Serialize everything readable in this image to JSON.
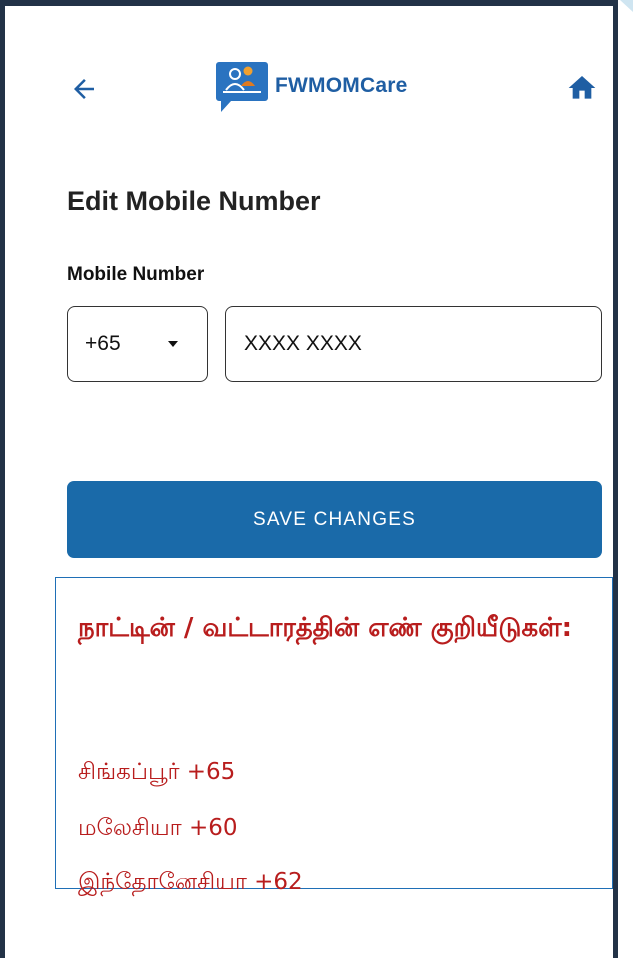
{
  "header": {
    "brand_name": "FWMOMCare"
  },
  "page": {
    "title": "Edit Mobile Number"
  },
  "form": {
    "mobile_label": "Mobile Number",
    "country_code": "+65",
    "phone_number": "XXXX XXXX",
    "save_label": "SAVE CHANGES"
  },
  "note": {
    "title": "நாட்டின் / வட்டாரத்தின் எண் குறியீடுகள்:",
    "lines": [
      "சிங்கப்பூர் +65",
      "மலேசியா +60",
      "இந்தோனேசியா +62"
    ]
  },
  "colors": {
    "brand_blue": "#1f5ea3",
    "button_blue": "#1a6aa9",
    "note_red": "#b81d1d",
    "frame_dark": "#223247"
  },
  "icons": {
    "back": "arrow-left-icon",
    "home": "home-icon",
    "logo": "fwmomcare-logo-icon",
    "dropdown": "caret-down-icon"
  }
}
